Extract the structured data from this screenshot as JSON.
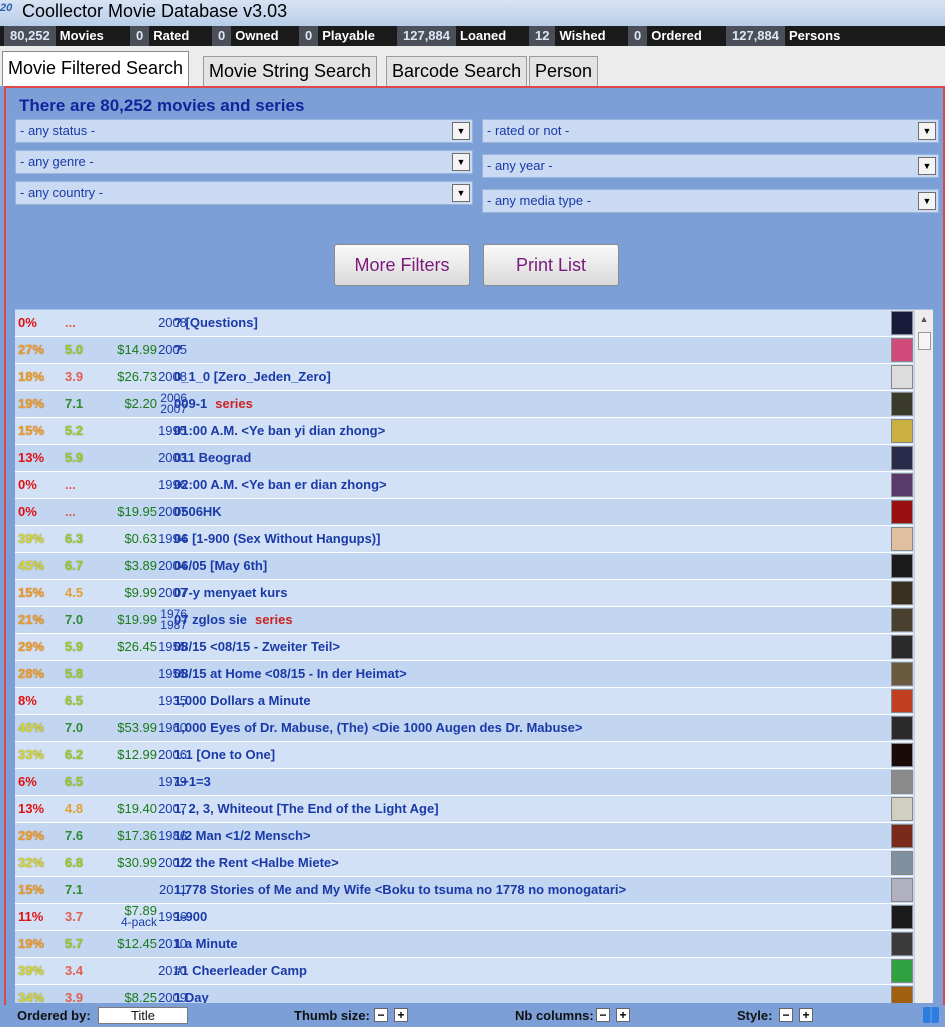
{
  "window": {
    "title": "Coollector Movie Database  v3.03"
  },
  "stats": [
    {
      "num": "80,252",
      "label": "Movies"
    },
    {
      "num": "0",
      "label": "Rated"
    },
    {
      "num": "0",
      "label": "Owned"
    },
    {
      "num": "0",
      "label": "Playable"
    },
    {
      "num": "127,884",
      "label": "Loaned"
    },
    {
      "num": "12",
      "label": "Wished"
    },
    {
      "num": "0",
      "label": "Ordered"
    },
    {
      "num": "127,884",
      "label": "Persons"
    }
  ],
  "tabs": [
    "Movie Filtered Search",
    "Movie String Search",
    "Barcode Search",
    "Person"
  ],
  "main": {
    "count_title": "There are 80,252 movies and series",
    "filters_left": [
      "- any status -",
      "- any genre -",
      "- any country -"
    ],
    "filters_right": [
      "- rated or not -",
      "- any year -",
      "- any media type -"
    ],
    "more_filters": "More Filters",
    "print_list": "Print List"
  },
  "rows": [
    {
      "pct": "0%",
      "pct_class": "pct-red",
      "rating": "...",
      "rate_class": "rate-red",
      "price": "",
      "year": "2008",
      "title": "? [Questions]",
      "thumb": "#1a1a3a"
    },
    {
      "pct": "27%",
      "pct_class": "pct-orange",
      "rating": "5.0",
      "rate_class": "rate-lime",
      "price": "$14.99",
      "year": "2005",
      "title": "?",
      "thumb": "#d04a7a"
    },
    {
      "pct": "18%",
      "pct_class": "pct-orange",
      "rating": "3.9",
      "rate_class": "rate-red",
      "price": "$26.73",
      "year": "2008",
      "title": "0_1_0 [Zero_Jeden_Zero]",
      "thumb": "#dcdcdc"
    },
    {
      "pct": "19%",
      "pct_class": "pct-orange",
      "rating": "7.1",
      "rate_class": "rate-green",
      "price": "$2.20",
      "year": "2006",
      "year2": "2007",
      "title": "009-1",
      "series": "series",
      "thumb": "#3a3a2a"
    },
    {
      "pct": "15%",
      "pct_class": "pct-orange",
      "rating": "5.2",
      "rate_class": "rate-lime",
      "price": "",
      "year": "1995",
      "title": "01:00 A.M. <Ye ban yi dian zhong>",
      "thumb": "#c9b040"
    },
    {
      "pct": "13%",
      "pct_class": "pct-red",
      "rating": "5.9",
      "rate_class": "rate-lime",
      "price": "",
      "year": "2003",
      "title": "011 Beograd",
      "thumb": "#2a2a4a"
    },
    {
      "pct": "0%",
      "pct_class": "pct-red",
      "rating": "...",
      "rate_class": "rate-red",
      "price": "",
      "year": "1996",
      "title": "02:00 A.M. <Ye ban er dian zhong>",
      "thumb": "#5a3a6a"
    },
    {
      "pct": "0%",
      "pct_class": "pct-red",
      "rating": "...",
      "rate_class": "rate-red",
      "price": "$19.95",
      "year": "2007",
      "title": "0506HK",
      "thumb": "#9a1010"
    },
    {
      "pct": "39%",
      "pct_class": "pct-yellow",
      "rating": "6.3",
      "rate_class": "rate-lime",
      "price": "$0.63",
      "year": "1994",
      "title": "06 [1-900 (Sex Without Hangups)]",
      "thumb": "#e0c0a0"
    },
    {
      "pct": "45%",
      "pct_class": "pct-yellow",
      "rating": "6.7",
      "rate_class": "rate-lime",
      "price": "$3.89",
      "year": "2004",
      "title": "06/05 [May 6th]",
      "thumb": "#1a1a1a"
    },
    {
      "pct": "15%",
      "pct_class": "pct-orange",
      "rating": "4.5",
      "rate_class": "rate-orange",
      "price": "$9.99",
      "year": "2007",
      "title": "07-y menyaet kurs",
      "thumb": "#3a3020"
    },
    {
      "pct": "21%",
      "pct_class": "pct-orange",
      "rating": "7.0",
      "rate_class": "rate-green",
      "price": "$19.99",
      "year": "1976",
      "year2": "1987",
      "title": "07 zglos sie",
      "series": "series",
      "thumb": "#4a4030"
    },
    {
      "pct": "29%",
      "pct_class": "pct-orange",
      "rating": "5.9",
      "rate_class": "rate-lime",
      "price": "$26.45",
      "year": "1955",
      "title": "08/15 <08/15 - Zweiter Teil>",
      "thumb": "#2a2a2a"
    },
    {
      "pct": "28%",
      "pct_class": "pct-orange",
      "rating": "5.8",
      "rate_class": "rate-lime",
      "price": "",
      "year": "1955",
      "title": "08/15 at Home <08/15 - In der Heimat>",
      "thumb": "#6a5a40"
    },
    {
      "pct": "8%",
      "pct_class": "pct-red",
      "rating": "6.5",
      "rate_class": "rate-lime",
      "price": "",
      "year": "1935",
      "title": "1,000 Dollars a Minute",
      "thumb": "#c04020"
    },
    {
      "pct": "46%",
      "pct_class": "pct-yellow",
      "rating": "7.0",
      "rate_class": "rate-green",
      "price": "$53.99",
      "year": "1960",
      "title": "1,000 Eyes of Dr. Mabuse, (The) <Die 1000 Augen des Dr. Mabuse>",
      "thumb": "#2a2a2a"
    },
    {
      "pct": "33%",
      "pct_class": "pct-yellow",
      "rating": "6.2",
      "rate_class": "rate-lime",
      "price": "$12.99",
      "year": "2006",
      "title": "1:1 [One to One]",
      "thumb": "#1a0a0a"
    },
    {
      "pct": "6%",
      "pct_class": "pct-red",
      "rating": "6.5",
      "rate_class": "rate-lime",
      "price": "",
      "year": "1979",
      "title": "1+1=3",
      "thumb": "#8a8a8a"
    },
    {
      "pct": "13%",
      "pct_class": "pct-red",
      "rating": "4.8",
      "rate_class": "rate-orange",
      "price": "$19.40",
      "year": "2007",
      "title": "1, 2, 3, Whiteout [The End of the Light Age]",
      "thumb": "#d0d0c0"
    },
    {
      "pct": "29%",
      "pct_class": "pct-orange",
      "rating": "7.6",
      "rate_class": "rate-green",
      "price": "$17.36",
      "year": "1986",
      "title": "1/2 Man <1/2 Mensch>",
      "thumb": "#7a2a1a"
    },
    {
      "pct": "32%",
      "pct_class": "pct-yellow",
      "rating": "6.8",
      "rate_class": "rate-lime",
      "price": "$30.99",
      "year": "2002",
      "title": "1/2 the Rent <Halbe Miete>",
      "thumb": "#8090a0"
    },
    {
      "pct": "15%",
      "pct_class": "pct-orange",
      "rating": "7.1",
      "rate_class": "rate-green",
      "price": "",
      "year": "2011",
      "title": "1,778 Stories of Me and My Wife <Boku to tsuma no 1778 no monogatari>",
      "thumb": "#b0b0c0"
    },
    {
      "pct": "11%",
      "pct_class": "pct-red",
      "rating": "3.7",
      "rate_class": "rate-red",
      "price": "$7.89",
      "pack": "4-pack",
      "year": "1996",
      "title": "1-900",
      "thumb": "#1a1a1a"
    },
    {
      "pct": "19%",
      "pct_class": "pct-orange",
      "rating": "5.7",
      "rate_class": "rate-lime",
      "price": "$12.45",
      "year": "2010",
      "title": "1 a Minute",
      "thumb": "#3a3a3a"
    },
    {
      "pct": "39%",
      "pct_class": "pct-yellow",
      "rating": "3.4",
      "rate_class": "rate-red",
      "price": "",
      "year": "2010",
      "title": "#1 Cheerleader Camp",
      "thumb": "#30a040"
    },
    {
      "pct": "34%",
      "pct_class": "pct-yellow",
      "rating": "3.9",
      "rate_class": "rate-red",
      "price": "$8.25",
      "year": "2009",
      "title": "1 Day",
      "thumb": "#a06010"
    }
  ],
  "footer": {
    "ordered_by_label": "Ordered by:",
    "ordered_by_value": "Title",
    "thumb_size_label": "Thumb size:",
    "nb_columns_label": "Nb columns:",
    "style_label": "Style:",
    "minus": "−",
    "plus": "+"
  }
}
